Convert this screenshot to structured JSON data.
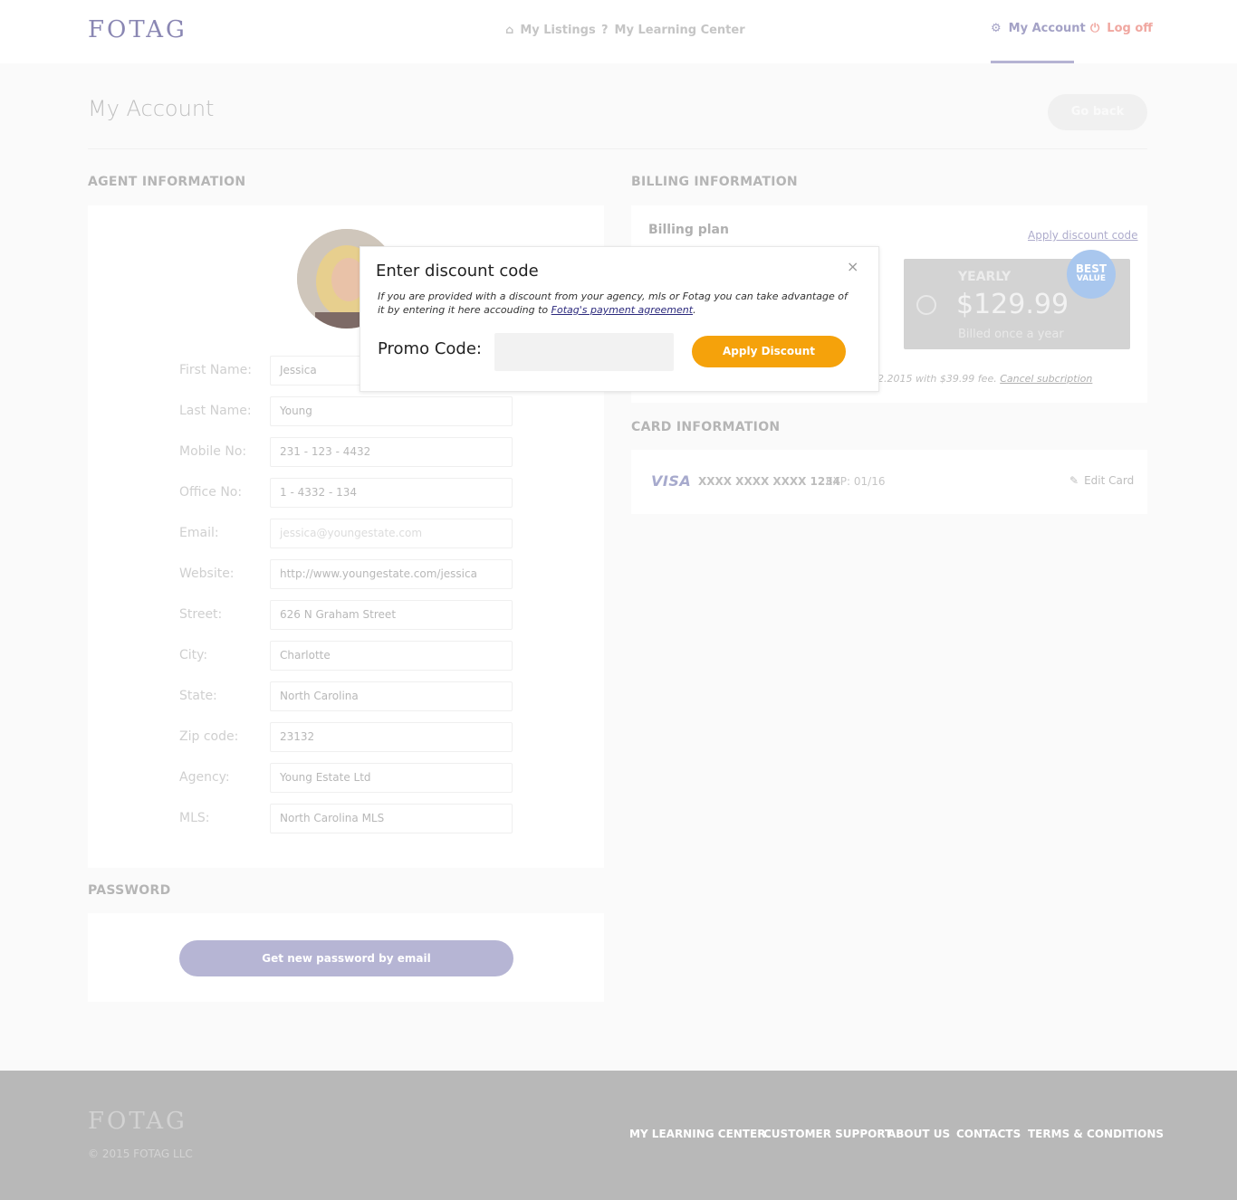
{
  "header": {
    "logo": "FOTAG",
    "nav": [
      {
        "label": "My Listings",
        "icon": "home-icon"
      },
      {
        "label": "My Learning Center",
        "icon": "question-circle-icon"
      }
    ],
    "account_label": "My Account",
    "logoff_label": "Log off"
  },
  "page": {
    "title": "My Account",
    "go_back": "Go back"
  },
  "agent": {
    "heading": "AGENT INFORMATION",
    "fields": [
      {
        "label": "First Name:",
        "value": "Jessica"
      },
      {
        "label": "Last Name:",
        "value": "Young"
      },
      {
        "label": "Mobile No:",
        "value": "231 - 123 - 4432"
      },
      {
        "label": "Office No:",
        "value": "1 - 4332 - 134"
      },
      {
        "label": "Email:",
        "value": "jessica@youngestate.com"
      },
      {
        "label": "Website:",
        "value": "http://www.youngestate.com/jessica"
      },
      {
        "label": "Street:",
        "value": "626 N Graham Street"
      },
      {
        "label": "City:",
        "value": "Charlotte"
      },
      {
        "label": "State:",
        "value": "North Carolina"
      },
      {
        "label": "Zip code:",
        "value": "23132"
      },
      {
        "label": "Agency:",
        "value": "Young Estate Ltd"
      },
      {
        "label": "MLS:",
        "value": "North Carolina MLS"
      }
    ]
  },
  "password": {
    "heading": "PASSWORD",
    "button": "Get new password by email"
  },
  "billing": {
    "heading": "BILLING INFORMATION",
    "plan_label": "Billing plan",
    "apply_discount_link": "Apply discount code",
    "yearly": {
      "label": "YEARLY",
      "price": "$129.99",
      "note": "Billed once a year",
      "badge_top": "BEST",
      "badge_bottom": "VALUE"
    },
    "renewal_text": "2.2015 with $39.99 fee.",
    "cancel_link": "Cancel subcription"
  },
  "card": {
    "heading": "CARD INFORMATION",
    "brand": "VISA",
    "number": "XXXX XXXX XXXX 1234",
    "expiry": "EXP: 01/16",
    "edit_label": "Edit Card"
  },
  "modal": {
    "title": "Enter discount code",
    "close": "×",
    "desc_before": "If you are provided with a discount from your agency, mls or Fotag you can take advantage of it by entering it here accouding to ",
    "desc_link": "Fotag's payment agreement",
    "desc_after": ".",
    "promo_label": "Promo Code:",
    "promo_value": "",
    "apply_button": "Apply Discount"
  },
  "footer": {
    "logo": "FOTAG",
    "copyright": "© 2015 FOTAG LLC",
    "links": [
      "MY LEARNING CENTER",
      "CUSTOMER SUPPORT",
      "ABOUT US",
      "CONTACTS",
      "TERMS & CONDITIONS"
    ]
  },
  "colors": {
    "accent": "#8a87b3",
    "orange": "#f5a20b",
    "logoff": "#f0a7a0",
    "badge": "#a9c7ee"
  }
}
